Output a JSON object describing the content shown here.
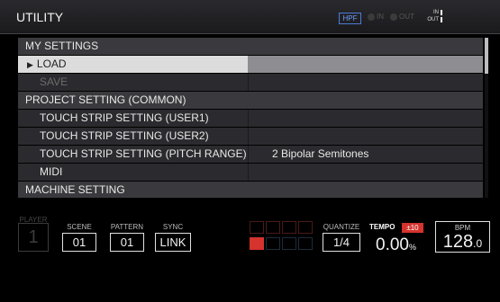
{
  "header": {
    "title": "UTILITY",
    "hpf": "HPF",
    "in_label": "IN",
    "out_label": "OUT",
    "meter_in": "IN",
    "meter_out": "OUT"
  },
  "menu": [
    {
      "label": "MY SETTINGS",
      "kind": "category"
    },
    {
      "label": "LOAD",
      "kind": "selected"
    },
    {
      "label": "SAVE",
      "kind": "disabled"
    },
    {
      "label": "PROJECT SETTING (COMMON)",
      "kind": "category"
    },
    {
      "label": "TOUCH STRIP SETTING (USER1)",
      "kind": "sub"
    },
    {
      "label": "TOUCH STRIP SETTING (USER2)",
      "kind": "sub"
    },
    {
      "label": "TOUCH STRIP SETTING (PITCH RANGE)",
      "kind": "sub",
      "value": "2 Bipolar Semitones"
    },
    {
      "label": "MIDI",
      "kind": "sub"
    },
    {
      "label": "MACHINE SETTING",
      "kind": "category"
    }
  ],
  "footer": {
    "player_label": "PLAYER",
    "player_value": "1",
    "scene_label": "SCENE",
    "scene_value": "01",
    "pattern_label": "PATTERN",
    "pattern_value": "01",
    "sync_label": "SYNC",
    "sync_value": "LINK",
    "quantize_label": "QUANTIZE",
    "quantize_value": "1/4",
    "tempo_label": "TEMPO",
    "tempo_range": "±10",
    "tempo_value": "0.00",
    "tempo_unit": "%",
    "bpm_label": "BPM",
    "bpm_int": "128",
    "bpm_dec": ".0"
  },
  "pads": {
    "active_index": 4,
    "active_color": "#d5332e"
  }
}
